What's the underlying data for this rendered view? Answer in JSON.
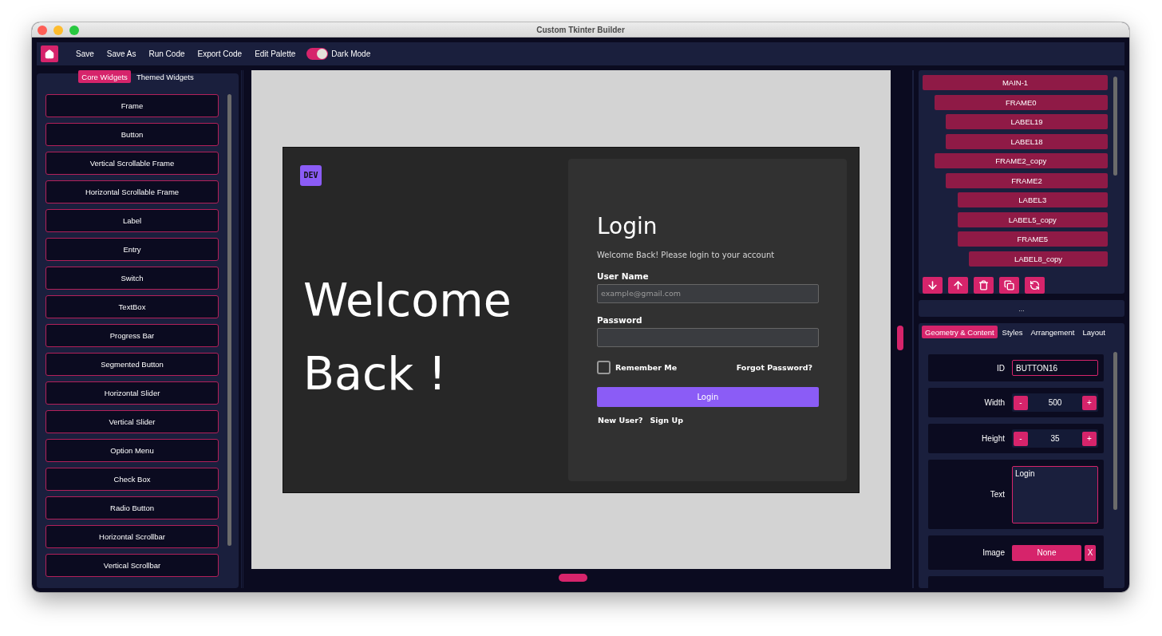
{
  "window": {
    "title": "Custom Tkinter Builder"
  },
  "toolbar": {
    "items": [
      "Save",
      "Save As",
      "Run Code",
      "Export Code",
      "Edit Palette"
    ],
    "dark_mode": {
      "label": "Dark Mode",
      "on": true
    }
  },
  "widget_panel": {
    "tabs": [
      {
        "label": "Core Widgets",
        "selected": true
      },
      {
        "label": "Themed Widgets",
        "selected": false
      }
    ],
    "widgets": [
      "Frame",
      "Button",
      "Vertical Scrollable Frame",
      "Horizontal Scrollable Frame",
      "Label",
      "Entry",
      "Switch",
      "TextBox",
      "Progress Bar",
      "Segmented Button",
      "Horizontal Slider",
      "Vertical Slider",
      "Option Menu",
      "Check Box",
      "Radio Button",
      "Horizontal Scrollbar",
      "Vertical Scrollbar"
    ]
  },
  "canvas": {
    "logo": "DEV",
    "headline": [
      "Welcome",
      "Back !"
    ],
    "login": {
      "title": "Login",
      "subtitle": "Welcome Back! Please login to your account",
      "fields": [
        {
          "label": "User Name",
          "placeholder": "example@gmail.com"
        },
        {
          "label": "Password"
        }
      ],
      "remember": {
        "label": "Remember Me",
        "checked": false
      },
      "forgot": "Forgot Password?",
      "button": "Login",
      "new_user": "New User?",
      "sign_up": "Sign Up"
    }
  },
  "tree": {
    "items": [
      {
        "label": "MAIN-1",
        "children": [
          {
            "label": "FRAME0",
            "children": [
              {
                "label": "LABEL19"
              },
              {
                "label": "LABEL18"
              }
            ]
          },
          {
            "label": "FRAME2_copy",
            "children": [
              {
                "label": "FRAME2",
                "children": [
                  {
                    "label": "LABEL3"
                  },
                  {
                    "label": "LABEL5_copy"
                  },
                  {
                    "label": "FRAME5",
                    "children": [
                      {
                        "label": "LABEL8_copy"
                      }
                    ]
                  }
                ]
              }
            ]
          }
        ]
      }
    ]
  },
  "splitter": "...",
  "properties": {
    "tabs": [
      {
        "label": "Geometry & Content",
        "selected": true
      },
      {
        "label": "Styles",
        "selected": false
      },
      {
        "label": "Arrangement",
        "selected": false
      },
      {
        "label": "Layout",
        "selected": false
      }
    ],
    "rows": [
      {
        "kind": "text",
        "label": "ID",
        "value": "BUTTON16"
      },
      {
        "kind": "stepper",
        "label": "Width",
        "value": "500",
        "minus": "-",
        "plus": "+"
      },
      {
        "kind": "stepper",
        "label": "Height",
        "value": "35",
        "minus": "-",
        "plus": "+"
      },
      {
        "kind": "textarea",
        "label": "Text",
        "value": "Login"
      },
      {
        "kind": "image",
        "label": "Image",
        "value": "None",
        "clear": "X"
      }
    ]
  }
}
